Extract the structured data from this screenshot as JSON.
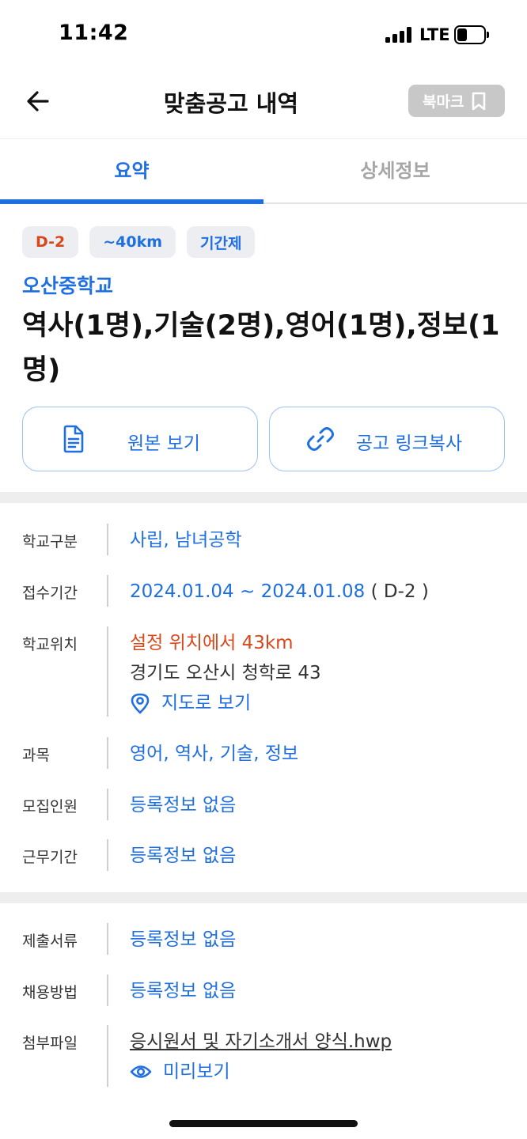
{
  "status_bar": {
    "time": "11:42",
    "network": "LTE"
  },
  "nav": {
    "title": "맞춤공고 내역",
    "bookmark_label": "북마크"
  },
  "tabs": [
    {
      "label": "요약",
      "active": true
    },
    {
      "label": "상세정보",
      "active": false
    }
  ],
  "chips": [
    "D-2",
    "~40km",
    "기간제"
  ],
  "school_name": "오산중학교",
  "post_title": "역사(1명),기술(2명),영어(1명),정보(1명)",
  "actions": {
    "original_label": "원본 보기",
    "copy_link_label": "공고 링크복사"
  },
  "info": {
    "school_type": {
      "label": "학교구분",
      "value": "사립, 남녀공학"
    },
    "period": {
      "label": "접수기간",
      "value": "2024.01.04 ~ 2024.01.08",
      "suffix": "( D-2 )"
    },
    "location": {
      "label": "학교위치",
      "distance": "설정 위치에서 43km",
      "address": "경기도 오산시 청학로 43",
      "map_link": "지도로 보기"
    },
    "subject": {
      "label": "과목",
      "value": "영어, 역사, 기술, 정보"
    },
    "recruit": {
      "label": "모집인원",
      "value": "등록정보 없음"
    },
    "work_period": {
      "label": "근무기간",
      "value": "등록정보 없음"
    },
    "documents": {
      "label": "제출서류",
      "value": "등록정보 없음"
    },
    "method": {
      "label": "채용방법",
      "value": "등록정보 없음"
    },
    "attachment": {
      "label": "첨부파일",
      "file": "응시원서 및 자기소개서 양식.hwp",
      "preview": "미리보기"
    }
  },
  "colors": {
    "accent": "#1f6fe0",
    "warning": "#d9471a",
    "muted": "#a6a6a6"
  }
}
